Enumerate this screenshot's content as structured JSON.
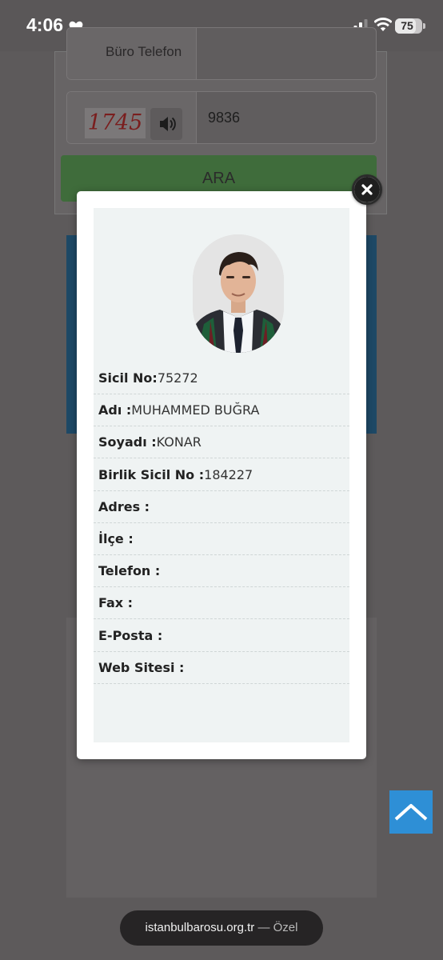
{
  "status_bar": {
    "time": "4:06",
    "battery": "75",
    "battery_level_pct": 75
  },
  "background": {
    "phone_label": "Büro Telefon",
    "captcha_code": "1745",
    "captcha_input_value": "9836",
    "search_button": "ARA"
  },
  "modal": {
    "fields": [
      {
        "label": "Sicil No:",
        "value": "75272"
      },
      {
        "label": "Adı :",
        "value": "MUHAMMED BUĞRA"
      },
      {
        "label": "Soyadı :",
        "value": "KONAR"
      },
      {
        "label": "Birlik Sicil No :",
        "value": "184227"
      },
      {
        "label": "Adres :",
        "value": ""
      },
      {
        "label": "İlçe :",
        "value": ""
      },
      {
        "label": "Telefon :",
        "value": ""
      },
      {
        "label": "Fax :",
        "value": ""
      },
      {
        "label": "E-Posta :",
        "value": ""
      },
      {
        "label": "Web Sitesi :",
        "value": ""
      }
    ]
  },
  "browser": {
    "domain": "istanbulbarosu.org.tr",
    "mode": "— Özel"
  },
  "colors": {
    "modal_bg": "#ffffff",
    "panel_bg": "#eff3f3",
    "scroll_top": "#2e8fd6",
    "url_pill": "#262425"
  }
}
